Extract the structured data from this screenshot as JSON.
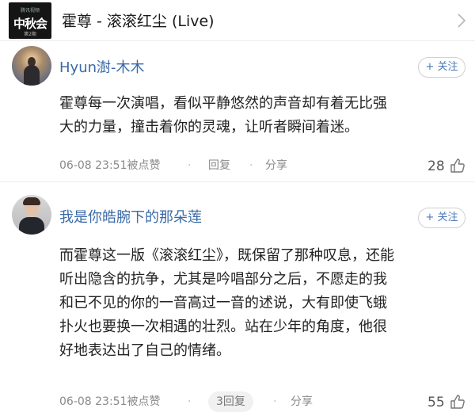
{
  "header": {
    "cover_top": "腾讯视频",
    "cover_main": "中秋会",
    "cover_sub": "第2期",
    "title": "霍尊 - 滚滚红尘 (Live)"
  },
  "comments": [
    {
      "username": "Hyun澍-木木",
      "follow_label": "+ 关注",
      "lines": [
        "霍尊每一次演唱，看似平静悠然的声音却有着无比强",
        "大的力量，撞击着你的灵魂，让听者瞬间着迷。"
      ],
      "time": "06-08 23:51被点赞",
      "reply_label": "回复",
      "share_label": "分享",
      "likes": "28"
    },
    {
      "username": "我是你皓腕下的那朵莲",
      "follow_label": "+ 关注",
      "lines": [
        "而霍尊这一版《滚滚红尘》，既保留了那种叹息，还能",
        "听出隐含的抗争，尤其是吟唱部分之后，不愿走的我",
        "和已不见的你的一音高过一音的述说，大有即使飞蛾",
        "扑火也要换一次相遇的壮烈。站在少年的角度，他很",
        "好地表达出了自己的情绪。"
      ],
      "time": "06-08 23:51被点赞",
      "reply_label": "3回复",
      "share_label": "分享",
      "likes": "55"
    }
  ],
  "colors": {
    "username": "#3a6aa8",
    "meta": "#8a8a8a",
    "divider": "#ececec"
  },
  "icons": [
    "chevron-right-icon",
    "thumb-up-icon"
  ]
}
